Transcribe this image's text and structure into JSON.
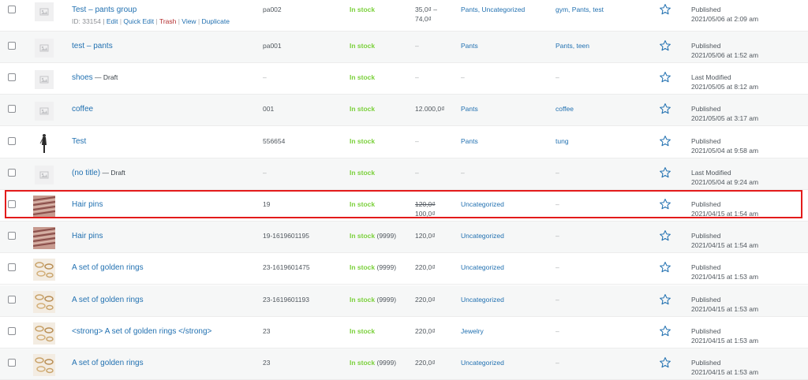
{
  "rows": [
    {
      "name": "Test – pants group",
      "draft": "",
      "sku": "pa002",
      "stock": "In stock",
      "stock_count": "",
      "price_lines": [
        "35,0₫ –",
        "74,0₫"
      ],
      "categories": "Pants, Uncategorized",
      "tags": "gym, Pants, test",
      "date_status": "Published",
      "date_value": "2021/05/06 at 2:09 am",
      "thumb": "placeholder",
      "actions": {
        "id": "ID: 33154 |",
        "edit": "Edit",
        "sep1": " | ",
        "quick_edit": "Quick Edit",
        "sep2": " | ",
        "trash": "Trash",
        "sep3": " | ",
        "view": "View",
        "sep4": " | ",
        "duplicate": "Duplicate"
      }
    },
    {
      "name": "test – pants",
      "draft": "",
      "sku": "pa001",
      "stock": "In stock",
      "stock_count": "",
      "price_lines": [
        "–"
      ],
      "categories": "Pants",
      "tags": "Pants, teen",
      "date_status": "Published",
      "date_value": "2021/05/06 at 1:52 am",
      "thumb": "placeholder"
    },
    {
      "name": "shoes",
      "draft": " — Draft",
      "sku": "–",
      "stock": "In stock",
      "stock_count": "",
      "price_lines": [
        "–"
      ],
      "categories": "–",
      "tags": "–",
      "date_status": "Last Modified",
      "date_value": "2021/05/05 at 8:12 am",
      "thumb": "placeholder"
    },
    {
      "name": "coffee",
      "draft": "",
      "sku": "001",
      "stock": "In stock",
      "stock_count": "",
      "price_lines": [
        "12.000,0₫"
      ],
      "categories": "Pants",
      "tags": "coffee",
      "date_status": "Published",
      "date_value": "2021/05/05 at 3:17 am",
      "thumb": "placeholder"
    },
    {
      "name": "Test",
      "draft": "",
      "sku": "556654",
      "stock": "In stock",
      "stock_count": "",
      "price_lines": [
        "–"
      ],
      "categories": "Pants",
      "tags": "tung",
      "date_status": "Published",
      "date_value": "2021/05/04 at 9:58 am",
      "thumb": "person"
    },
    {
      "name": "(no title)",
      "draft": " — Draft",
      "sku": "–",
      "stock": "In stock",
      "stock_count": "",
      "price_lines": [
        "–"
      ],
      "categories": "–",
      "tags": "–",
      "date_status": "Last Modified",
      "date_value": "2021/05/04 at 9:24 am",
      "thumb": "placeholder"
    },
    {
      "name": "Hair pins",
      "draft": "",
      "sku": "19",
      "stock": "In stock",
      "stock_count": "",
      "price_regular": "120,0₫",
      "price_sale": "100,0₫",
      "categories": "Uncategorized",
      "tags": "–",
      "date_status": "Published",
      "date_value": "2021/04/15 at 1:54 am",
      "thumb": "hairpins"
    },
    {
      "name": "Hair pins",
      "draft": "",
      "sku": "19-1619601195",
      "stock": "In stock",
      "stock_count": " (9999)",
      "price_lines": [
        "120,0₫"
      ],
      "categories": "Uncategorized",
      "tags": "–",
      "date_status": "Published",
      "date_value": "2021/04/15 at 1:54 am",
      "thumb": "hairpins"
    },
    {
      "name": "A set of golden rings",
      "draft": "",
      "sku": "23-1619601475",
      "stock": "In stock",
      "stock_count": " (9999)",
      "price_lines": [
        "220,0₫"
      ],
      "categories": "Uncategorized",
      "tags": "–",
      "date_status": "Published",
      "date_value": "2021/04/15 at 1:53 am",
      "thumb": "rings"
    },
    {
      "name": "A set of golden rings",
      "draft": "",
      "sku": "23-1619601193",
      "stock": "In stock",
      "stock_count": " (9999)",
      "price_lines": [
        "220,0₫"
      ],
      "categories": "Uncategorized",
      "tags": "–",
      "date_status": "Published",
      "date_value": "2021/04/15 at 1:53 am",
      "thumb": "rings"
    },
    {
      "name": "<strong> A set of golden rings </strong>",
      "draft": "",
      "sku": "23",
      "stock": "In stock",
      "stock_count": "",
      "price_lines": [
        "220,0₫"
      ],
      "categories": "Jewelry",
      "tags": "–",
      "date_status": "Published",
      "date_value": "2021/04/15 at 1:53 am",
      "thumb": "rings"
    },
    {
      "name": "A set of golden rings",
      "draft": "",
      "sku": "23",
      "stock": "In stock",
      "stock_count": " (9999)",
      "price_lines": [
        "220,0₫"
      ],
      "categories": "Uncategorized",
      "tags": "–",
      "date_status": "Published",
      "date_value": "2021/04/15 at 1:53 am",
      "thumb": "rings"
    }
  ],
  "highlight_row": 6,
  "colors": {
    "link": "#2271b1",
    "in_stock": "#7ad03a",
    "highlight": "#e31b1b",
    "trash": "#b32d2e",
    "alt_row": "#f6f7f7"
  }
}
